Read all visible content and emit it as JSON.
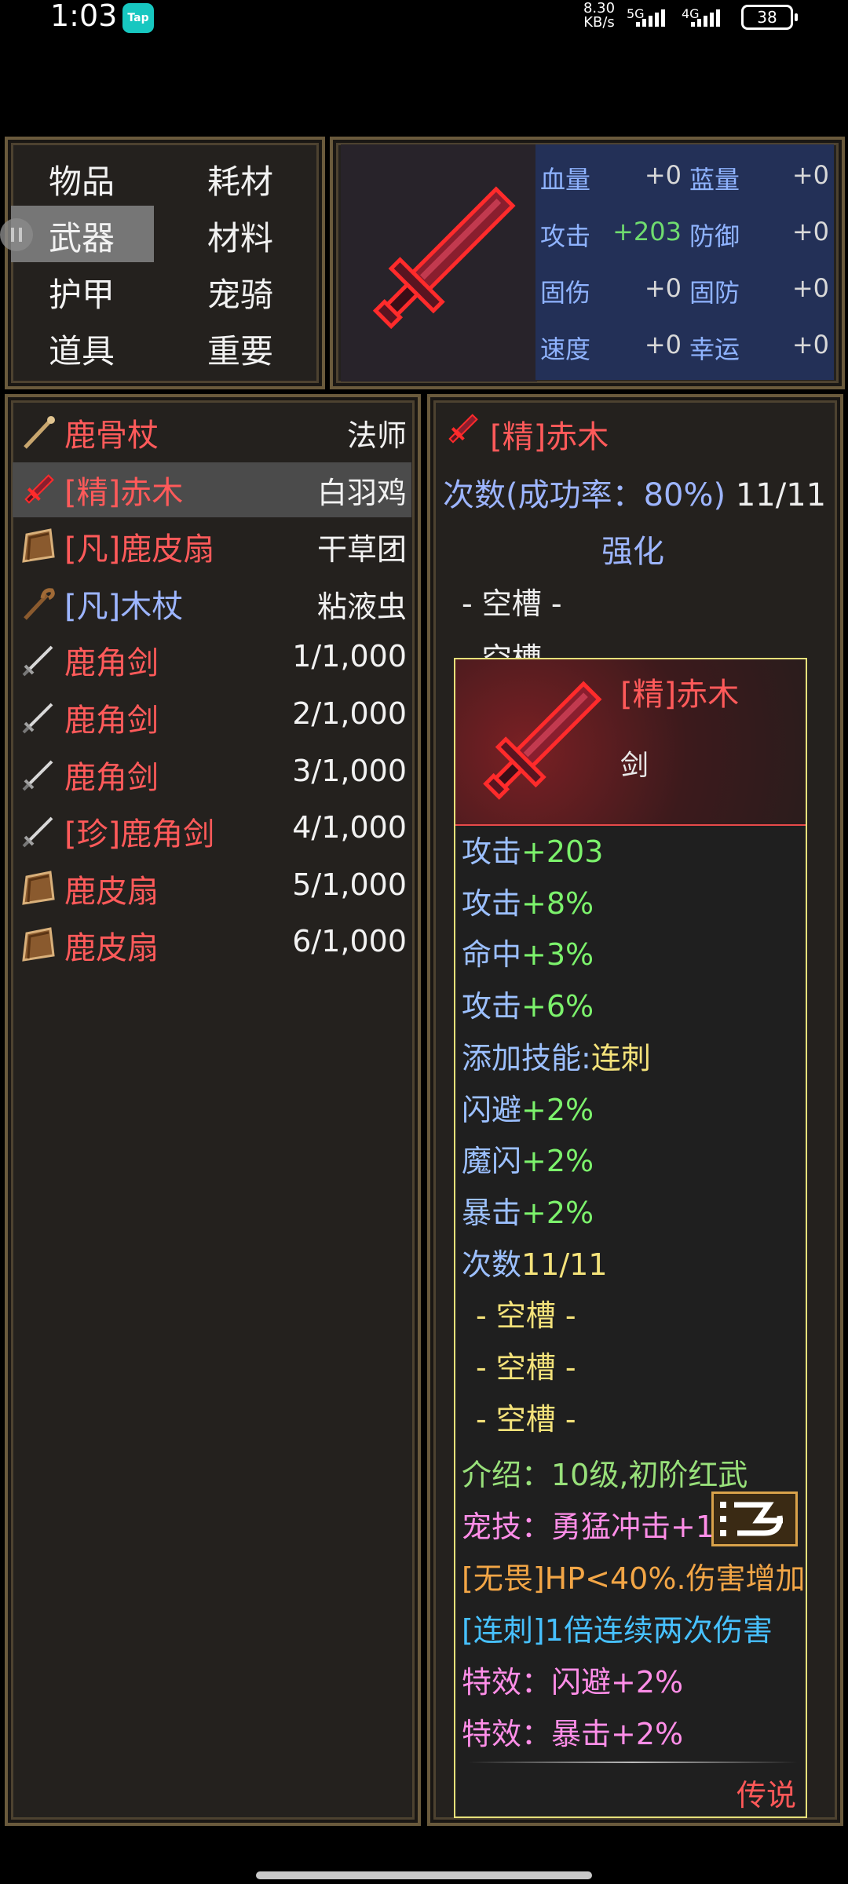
{
  "status_bar": {
    "time": "1:03",
    "app_badge": "Tap",
    "net_speed_value": "8.30",
    "net_speed_unit": "KB/s",
    "sig1": "5G",
    "sig2": "4G",
    "battery": "38"
  },
  "categories": [
    "物品",
    "耗材",
    "武器",
    "材料",
    "护甲",
    "宠骑",
    "道具",
    "重要"
  ],
  "selected_category": "武器",
  "stats": {
    "hp_label": "血量",
    "hp_value": "+0",
    "mp_label": "蓝量",
    "mp_value": "+0",
    "atk_label": "攻击",
    "atk_value": "+203",
    "def_label": "防御",
    "def_value": "+0",
    "fdmg_label": "固伤",
    "fdmg_value": "+0",
    "fdef_label": "固防",
    "fdef_value": "+0",
    "spd_label": "速度",
    "spd_value": "+0",
    "luck_label": "幸运",
    "luck_value": "+0"
  },
  "items": [
    {
      "name": "鹿骨杖",
      "aux": "法师",
      "color": "#ff5a5a",
      "icon": "staff-icon"
    },
    {
      "name": "[精]赤木",
      "aux": "白羽鸡",
      "color": "#ff5a5a",
      "icon": "red-sword-icon"
    },
    {
      "name": "[凡]鹿皮扇",
      "aux": "干草团",
      "color": "#ff5a5a",
      "icon": "fan-icon"
    },
    {
      "name": "[凡]木杖",
      "aux": "粘液虫",
      "color": "#9db5ff",
      "icon": "wood-staff-icon"
    },
    {
      "name": "鹿角剑",
      "aux": "1/1,000",
      "color": "#ff5a5a",
      "icon": "sword-icon"
    },
    {
      "name": "鹿角剑",
      "aux": "2/1,000",
      "color": "#ff5a5a",
      "icon": "sword-icon"
    },
    {
      "name": "鹿角剑",
      "aux": "3/1,000",
      "color": "#ff5a5a",
      "icon": "sword-icon"
    },
    {
      "name": "[珍]鹿角剑",
      "aux": "4/1,000",
      "color": "#ff5a5a",
      "icon": "sword-icon"
    },
    {
      "name": "鹿皮扇",
      "aux": "5/1,000",
      "color": "#ff5a5a",
      "icon": "fan-icon"
    },
    {
      "name": "鹿皮扇",
      "aux": "6/1,000",
      "color": "#ff5a5a",
      "icon": "fan-icon"
    }
  ],
  "detail": {
    "title": "[精]赤木",
    "count_label": "次数(成功率：80%)",
    "count_value": "11/11",
    "enhance": "强化",
    "slot1": "- 空槽 -",
    "slot2": "- 空槽 -"
  },
  "tooltip": {
    "name": "[精]赤木",
    "type": "剑",
    "lines": [
      {
        "label": "攻击",
        "value": "+203"
      },
      {
        "label": "攻击",
        "value": "+8%"
      },
      {
        "label": "命中",
        "value": "+3%"
      },
      {
        "label": "攻击",
        "value": "+6%"
      },
      {
        "label": "添加技能:",
        "value": "连刺"
      },
      {
        "label": "闪避",
        "value": "+2%"
      },
      {
        "label": "魔闪",
        "value": "+2%"
      },
      {
        "label": "暴击",
        "value": "+2%"
      },
      {
        "label": "次数",
        "value": "11/11"
      }
    ],
    "slots": [
      "- 空槽 -",
      "- 空槽 -",
      "- 空槽 -"
    ],
    "intro": "介绍：10级,初阶红武",
    "pet_skill": "宠技：勇猛冲击+1",
    "fearless": "[无畏]HP<40%.伤害增加",
    "combo": "[连刺]1倍连续两次伤害",
    "effect1": "特效：闪避+2%",
    "effect2": "特效：暴击+2%",
    "rarity": "传说"
  }
}
